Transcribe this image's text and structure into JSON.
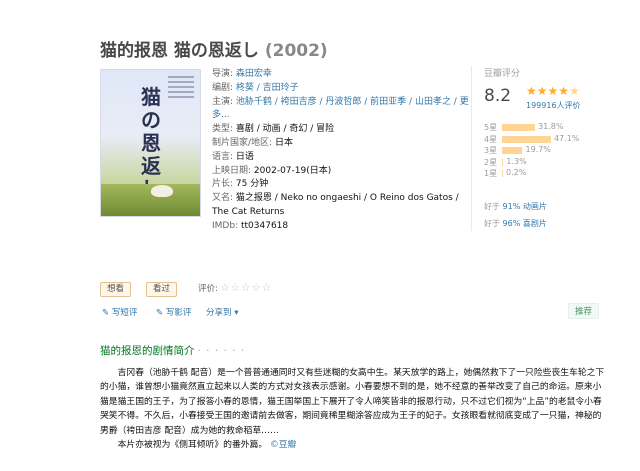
{
  "movie": {
    "title": "猫的报恩 猫の恩返し",
    "year": "(2002)"
  },
  "poster": {
    "title_text": "猫の恩返し"
  },
  "info": {
    "director_label": "导演:",
    "director": "森田宏幸",
    "writers_label": "编剧:",
    "writers": "柊葵 / 吉田玲子",
    "cast_label": "主演:",
    "cast": "池胁千鹤 / 袴田吉彦 / 丹波哲郎 / 前田亚季 / 山田孝之 / 更多...",
    "genre_label": "类型:",
    "genre": "喜剧 / 动画 / 奇幻 / 冒险",
    "country_label": "制片国家/地区:",
    "country": "日本",
    "language_label": "语言:",
    "language": "日语",
    "release_label": "上映日期:",
    "release": "2002-07-19(日本)",
    "runtime_label": "片长:",
    "runtime": "75 分钟",
    "aka_label": "又名:",
    "aka": "猫之报恩 / Neko no ongaeshi / O Reino dos Gatos / The Cat Returns",
    "imdb_label": "IMDb:",
    "imdb": "tt0347618"
  },
  "rating": {
    "header": "豆瓣评分",
    "score": "8.2",
    "stars": "★★★★",
    "half_star": "★",
    "people": "199916人评价",
    "distribution": [
      {
        "label": "5星",
        "value": 31.8,
        "text": "31.8%"
      },
      {
        "label": "4星",
        "value": 47.1,
        "text": "47.1%"
      },
      {
        "label": "3星",
        "value": 19.7,
        "text": "19.7%"
      },
      {
        "label": "2星",
        "value": 1.3,
        "text": "1.3%"
      },
      {
        "label": "1星",
        "value": 0.2,
        "text": "0.2%"
      }
    ],
    "better1_prefix": "好于",
    "better1_pct": "91%",
    "better1_cat": "动画片",
    "better2_prefix": "好于",
    "better2_pct": "96%",
    "better2_cat": "喜剧片"
  },
  "actions": {
    "want": "想看",
    "seen": "看过",
    "rate_label": "评价:",
    "empty_stars": "☆☆☆☆☆"
  },
  "tools": {
    "short_review": "写短评",
    "review": "写影评",
    "share": "分享到",
    "recommend": "推荐"
  },
  "summary": {
    "section_title": "猫的报恩的剧情简介",
    "dots": "· · · · · ·",
    "para1": "吉冈春（池胁千鹤 配音）是一个普普通通同时又有些迷糊的女高中生。某天放学的路上，她偶然救下了一只险些丧生车轮之下的小猫，谁曾想小猫竟然直立起来以人类的方式对女孩表示感谢。小春要想不到的是，她不经意的善举改变了自己的命运。原来小猫是猫王国的王子，为了报答小春的恩情，猫王国举国上下展开了令人啼笑皆非的报恩行动，只不过它们视为“上品”的老鼠令小春哭笑不得。不久后，小春接受王国的邀请前去做客，期间竟稀里糊涂答应成为王子的妃子。女孩眼看就彻底变成了一只猫，神秘的男爵（袴田吉彦 配音）成为她的救命稻草……",
    "para2": "本片亦被视为《侧耳倾听》的番外篇。",
    "source": "©豆瓣"
  }
}
